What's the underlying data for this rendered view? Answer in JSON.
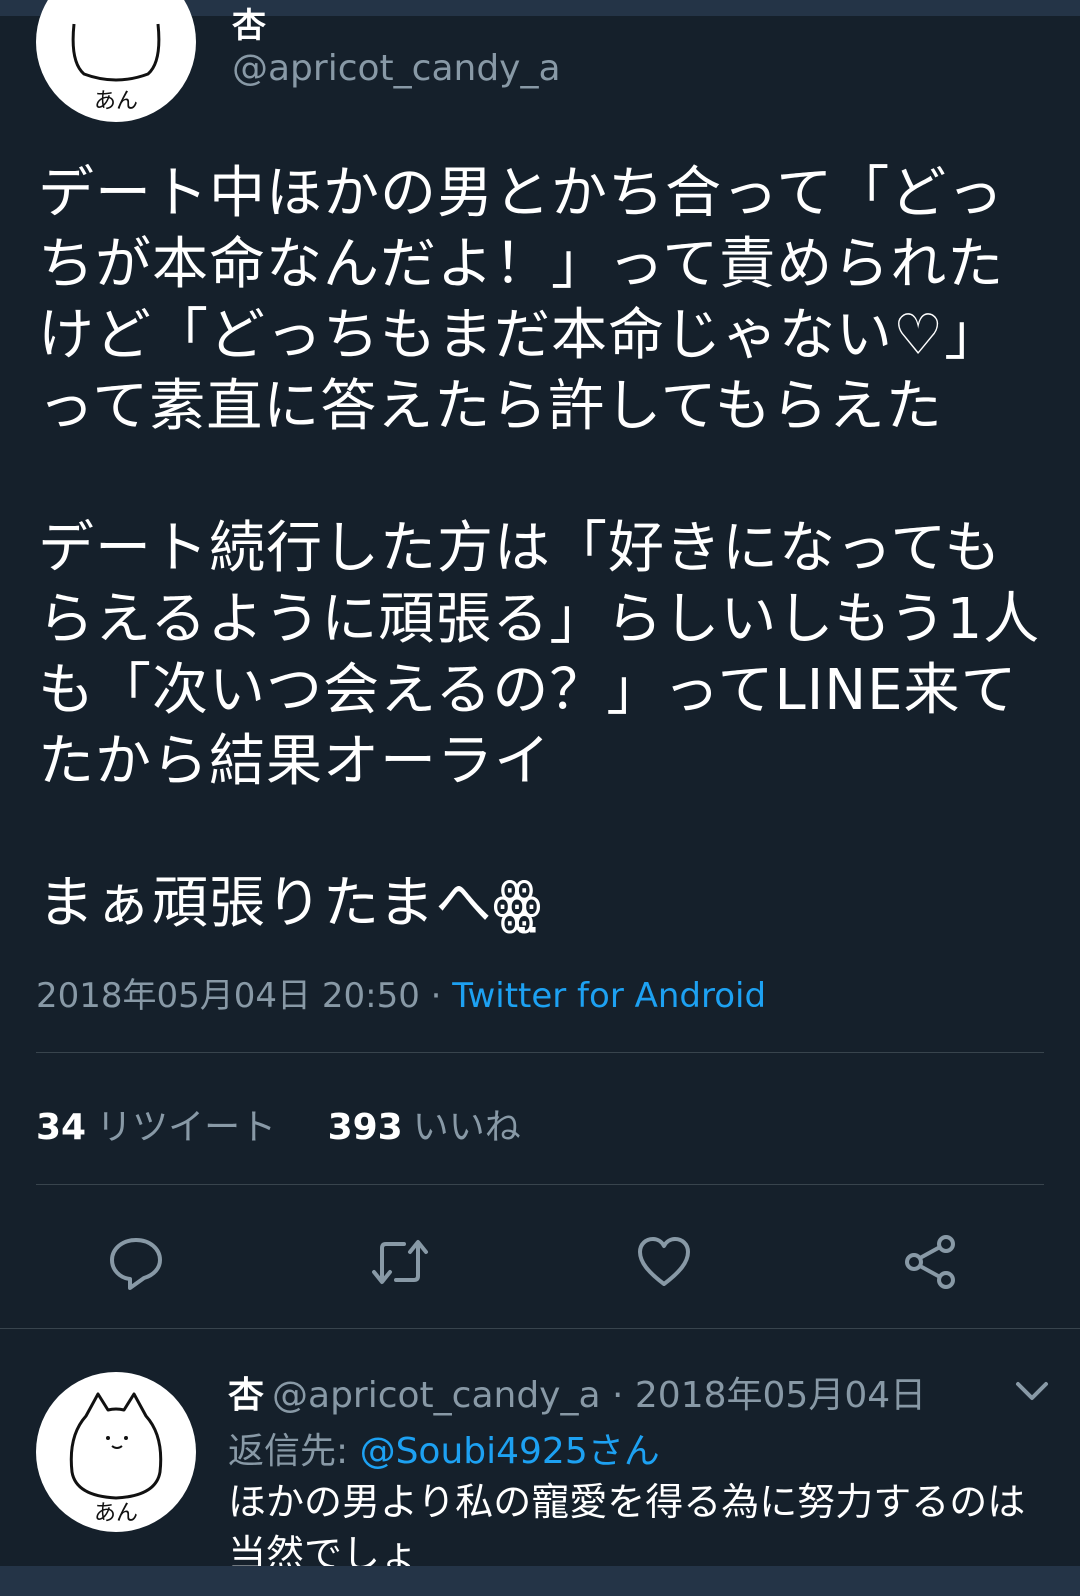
{
  "colors": {
    "background": "#15202b",
    "text": "#ffffff",
    "muted": "#8899a6",
    "link": "#1da1f2",
    "divider": "#38444d",
    "bar": "#243447"
  },
  "tweet": {
    "author_name": "杏",
    "author_handle": "@apricot_candy_a",
    "avatar_caption": "あん",
    "body_paragraph_1": "デート中ほかの男とかち合って「どっちが本命なんだよ！」って責められたけど「どっちもまだ本命じゃない♡」って素直に答えたら許してもらえた",
    "body_paragraph_2": "デート続行した方は「好きになってもらえるように頑張る」らしいしもう1人も「次いつ会えるの？」ってLINE来てたから結果オーライ",
    "body_paragraph_3": "まぁ頑張りたまへ",
    "body_emoji": "ꙮ̤",
    "timestamp": "2018年05月04日 20:50",
    "separator": " · ",
    "source": "Twitter for Android",
    "retweet_count": "34",
    "retweet_label": "リツイート",
    "like_count": "393",
    "like_label": "いいね"
  },
  "actions": {
    "reply_icon": "reply-icon",
    "retweet_icon": "retweet-icon",
    "like_icon": "heart-icon",
    "share_icon": "share-icon"
  },
  "reply": {
    "author_name": "杏",
    "author_handle": "@apricot_candy_a",
    "separator": " · ",
    "date": "2018年05月04日",
    "avatar_caption": "あん",
    "replying_to_label": "返信先: ",
    "replying_to_mention": "@Soubi4925さん",
    "text": "ほかの男より私の寵愛を得る為に努力するのは当然でしょ"
  }
}
